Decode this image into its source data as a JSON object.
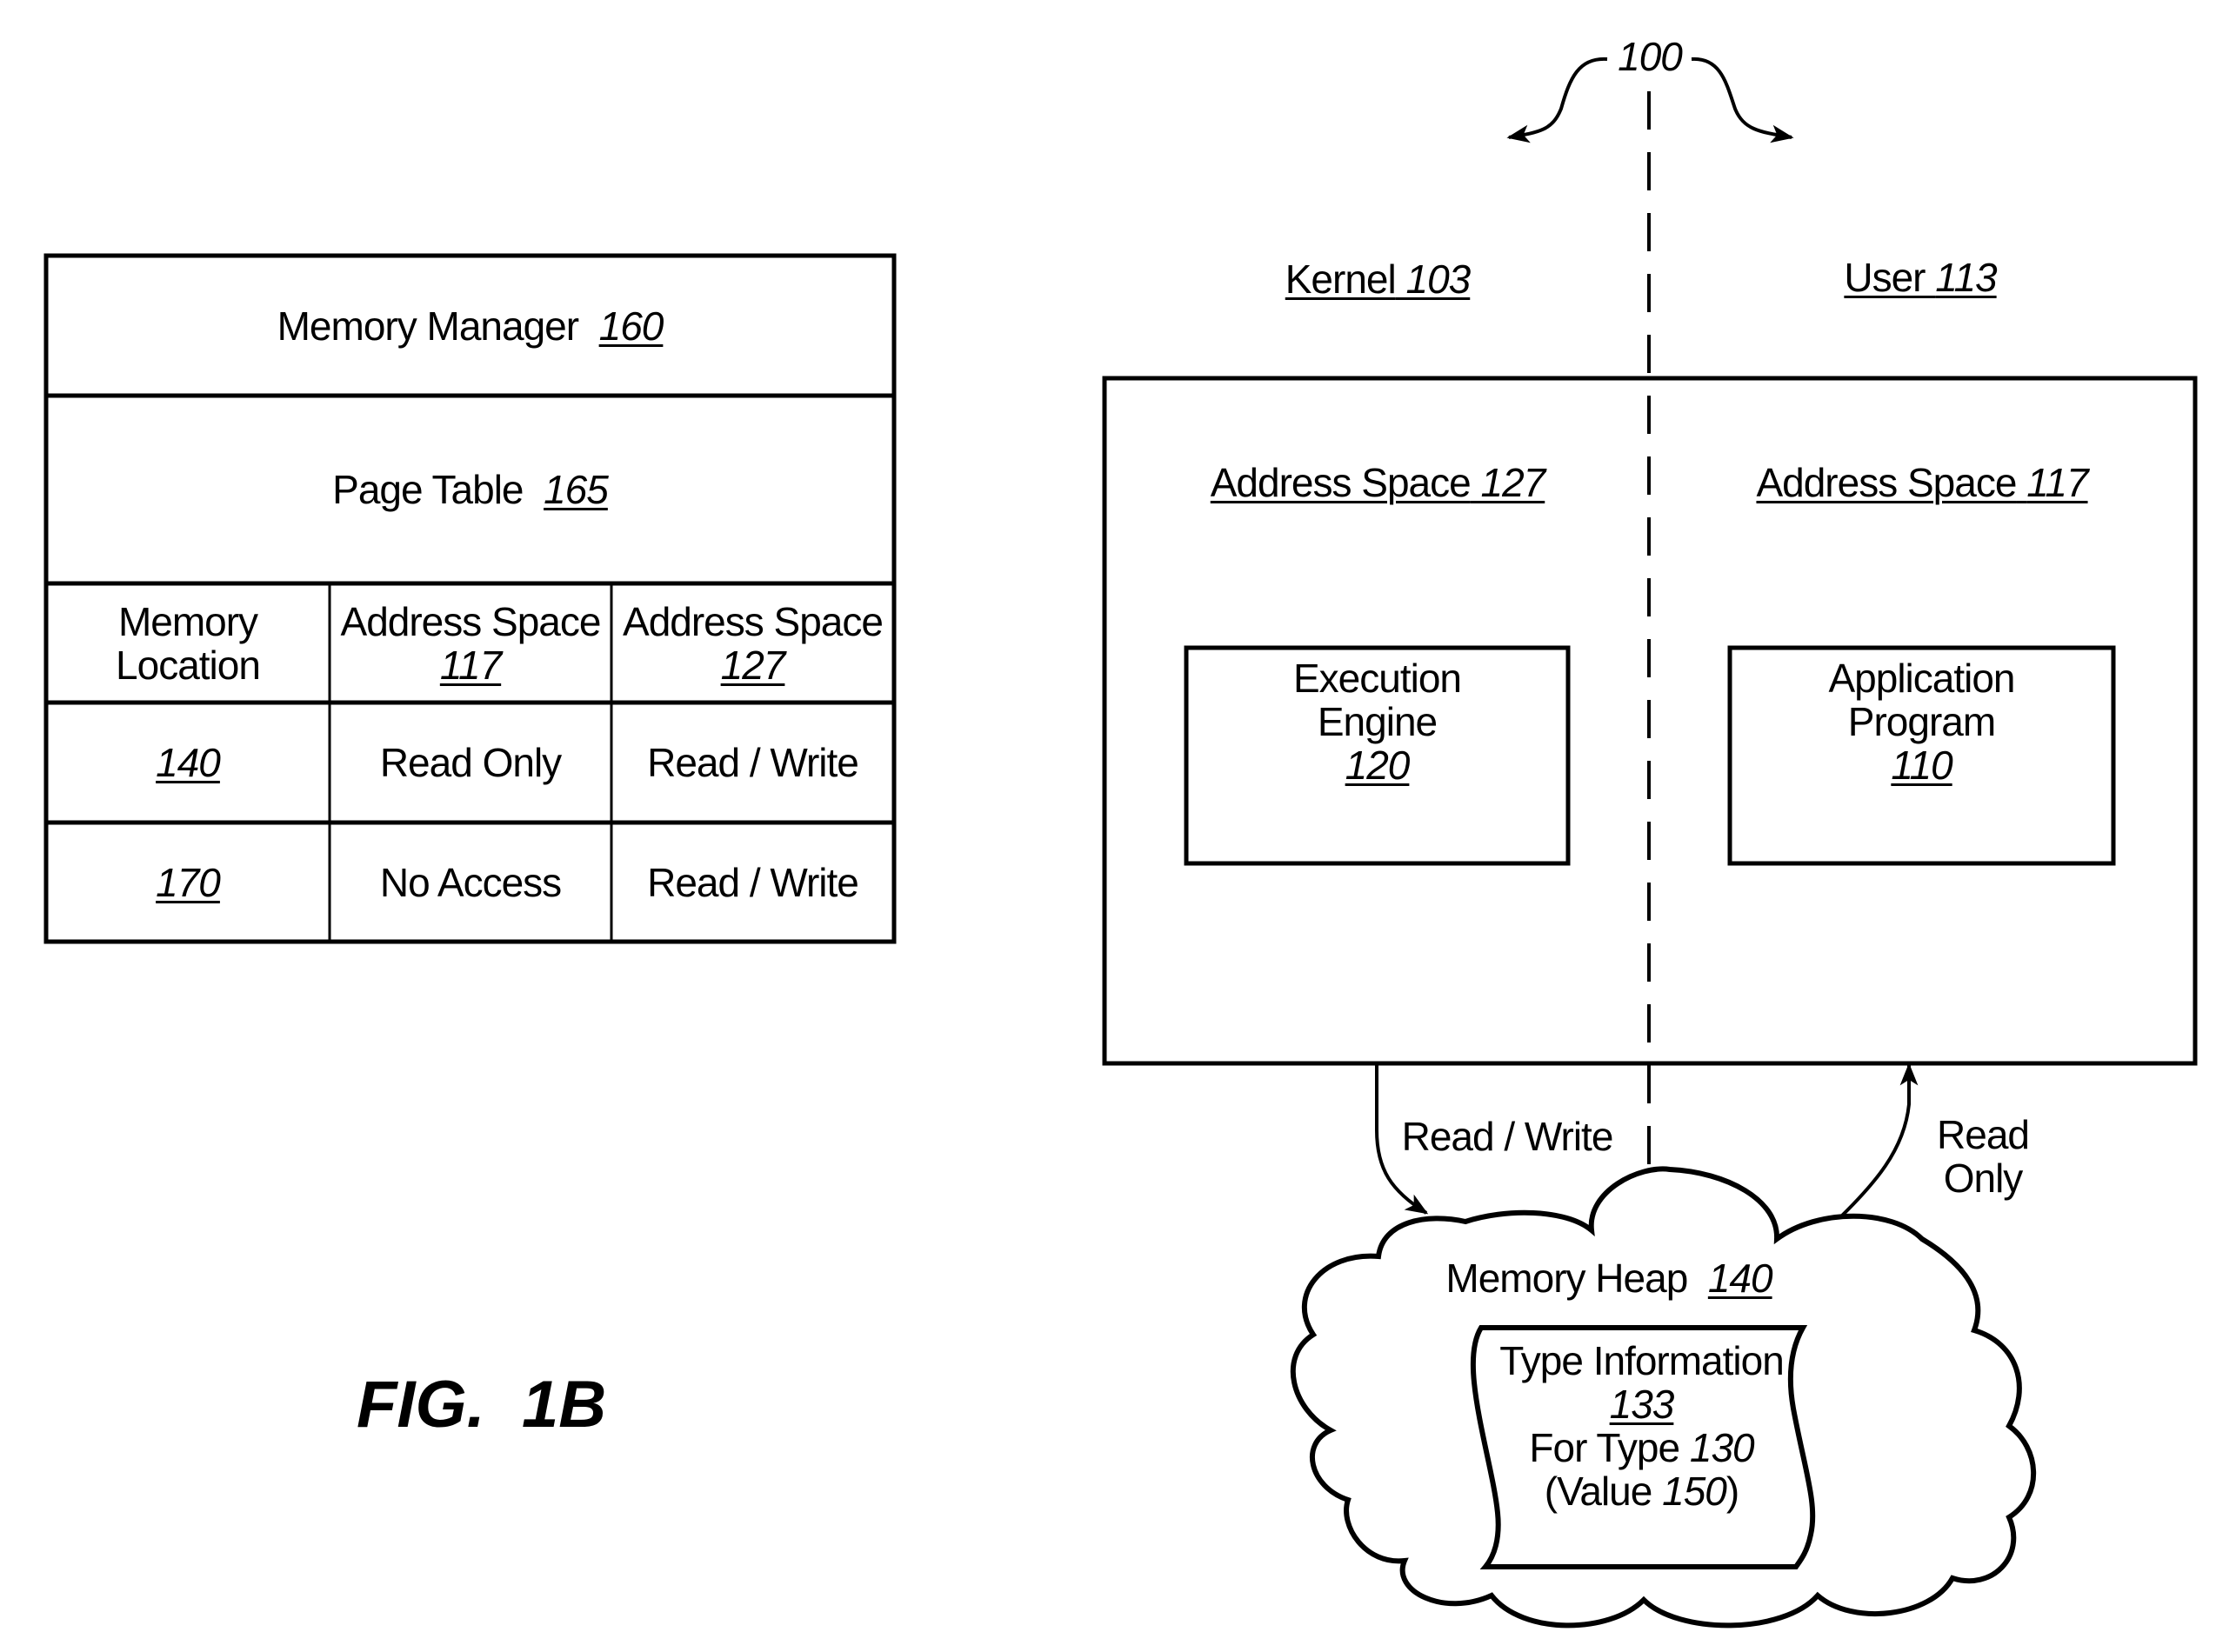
{
  "figure": {
    "label": "FIG.  1B",
    "ref_system": "100"
  },
  "memory_manager": {
    "title": "Memory Manager",
    "ref": "160",
    "page_table": {
      "title": "Page Table",
      "ref": "165",
      "columns": [
        {
          "label": "Memory Location",
          "line1": "Memory",
          "line2": "Location",
          "ref": ""
        },
        {
          "label": "Address Space",
          "line1": "Address Space",
          "ref": "117"
        },
        {
          "label": "Address Space",
          "line1": "Address Space",
          "ref": "127"
        }
      ],
      "rows": [
        {
          "location": "140",
          "as117": "Read Only",
          "as127": "Read / Write"
        },
        {
          "location": "170",
          "as117": "No Access",
          "as127": "Read / Write"
        }
      ]
    }
  },
  "system": {
    "kernel": {
      "label": "Kernel",
      "ref": "103"
    },
    "user": {
      "label": "User",
      "ref": "113"
    },
    "address_space_kernel": {
      "label": "Address Space",
      "ref": "127"
    },
    "address_space_user": {
      "label": "Address Space",
      "ref": "117"
    },
    "execution_engine": {
      "line1": "Execution",
      "line2": "Engine",
      "ref": "120"
    },
    "application_program": {
      "line1": "Application",
      "line2": "Program",
      "ref": "110"
    },
    "arrow_left_label": "Read / Write",
    "arrow_right_label_line1": "Read",
    "arrow_right_label_line2": "Only",
    "memory_heap": {
      "label": "Memory Heap",
      "ref": "140"
    },
    "type_info": {
      "line1": "Type Information",
      "ref": "133",
      "line3_prefix": "For Type",
      "type_ref": "130",
      "line4_prefix": "(Value",
      "value_ref": "150",
      "line4_suffix": ")"
    }
  }
}
